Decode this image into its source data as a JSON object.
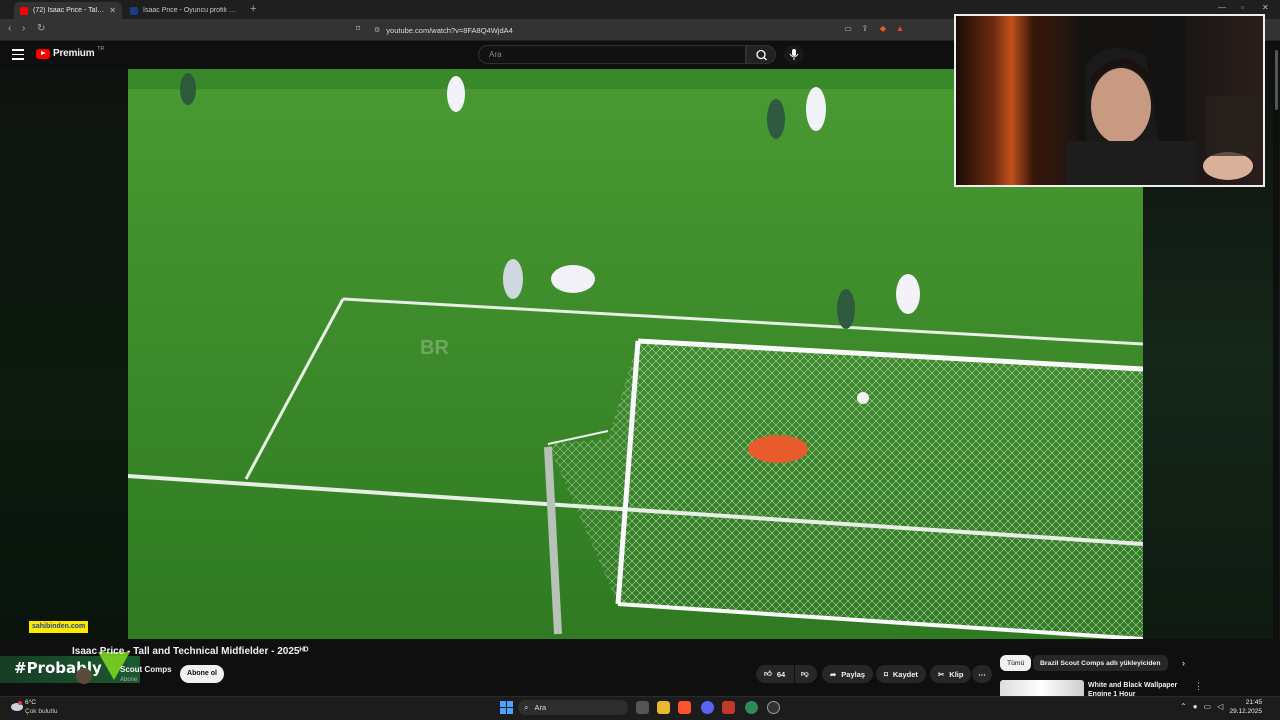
{
  "browser": {
    "tabs": [
      {
        "label": "(72) Isaac Price - Tall and Technic",
        "active": true,
        "favicon_color": "#ff0000"
      },
      {
        "label": "Isaac Price - Oyuncu profili 25/26 | Tr",
        "active": false,
        "favicon_color": "#1a3a8a"
      }
    ],
    "url": "youtube.com/watch?v=8FA8Q4WjdA4"
  },
  "header": {
    "logo_text": "Premium",
    "logo_sup": "TR",
    "search_placeholder": "Ara"
  },
  "video": {
    "watermark": "BR",
    "overlay_sponsor": "sahibinden.com",
    "overlay_handle": "#Probably"
  },
  "meta": {
    "title": "Isaac Price - Tall and Technical Midfielder - 2025ᴴᴰ",
    "channel": "Scout Comps",
    "subscribers": "Abone",
    "subscribe_label": "Abone ol",
    "likes": "64",
    "share_label": "Paylaş",
    "save_label": "Kaydet",
    "clip_label": "Klip"
  },
  "suggestions": {
    "chips": [
      "Tümü",
      "Brazil Scout Comps adlı yükleyiciden"
    ],
    "first_title": "White and Black Wallpaper Engine 1 Hour"
  },
  "taskbar": {
    "weather_temp": "6°C",
    "weather_desc": "Çok bulutlu",
    "search_label": "Ara",
    "time": "21:45",
    "date": "29.12.2025"
  },
  "colors": {
    "accent": "#ff0000",
    "pitch": "#3d8a2c",
    "subscribe_bg": "#f1f1f1"
  }
}
